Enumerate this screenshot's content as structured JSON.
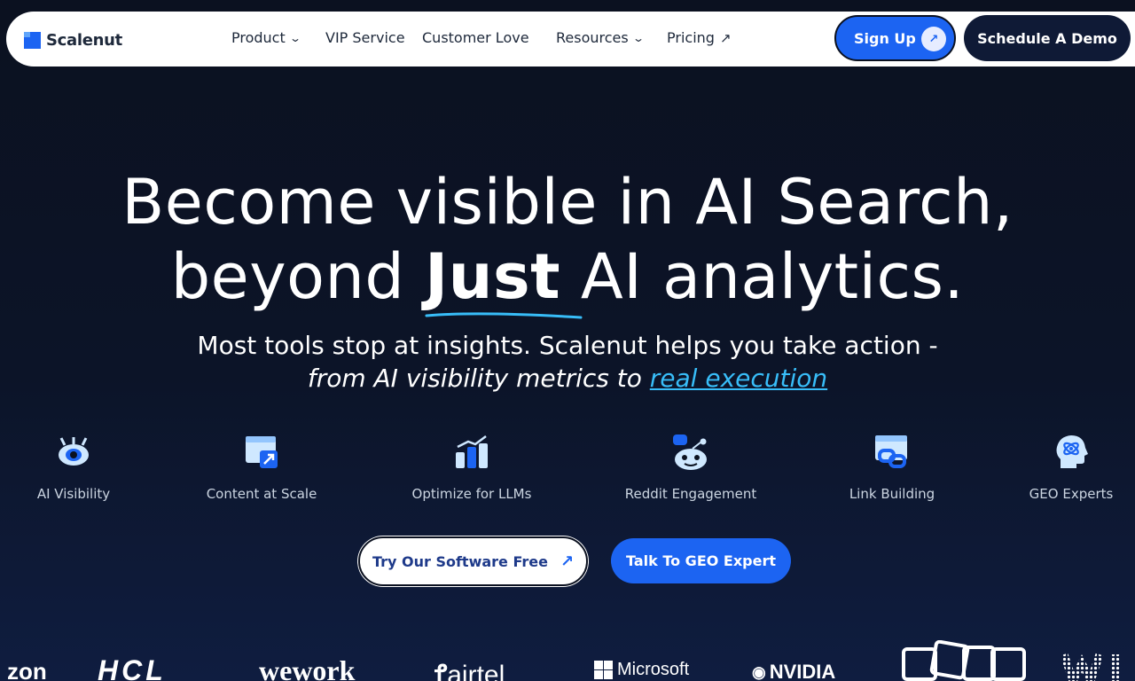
{
  "nav": {
    "brand": "Scalenut",
    "items": [
      {
        "label": "Product",
        "has_dropdown": true
      },
      {
        "label": "VIP Service",
        "has_dropdown": false
      },
      {
        "label": "Customer Love",
        "has_dropdown": false
      },
      {
        "label": "Resources",
        "has_dropdown": true
      },
      {
        "label": "Pricing",
        "external": true
      }
    ],
    "signup_label": "Sign Up",
    "demo_label": "Schedule A Demo"
  },
  "hero": {
    "line1": "Become visible in AI Search,",
    "line2_pre": "beyond ",
    "line2_emph": "Just",
    "line2_post": " AI analytics.",
    "sub1": "Most tools stop at insights. Scalenut helps you take action -",
    "sub2_pre": "from AI visibility metrics to ",
    "sub2_link": "real execution"
  },
  "features": [
    {
      "label": "AI Visibility",
      "icon": "eye-robot-icon"
    },
    {
      "label": "Content at Scale",
      "icon": "window-expand-icon"
    },
    {
      "label": "Optimize for LLMs",
      "icon": "bar-chart-icon"
    },
    {
      "label": "Reddit Engagement",
      "icon": "reddit-icon"
    },
    {
      "label": "Link Building",
      "icon": "link-icon"
    },
    {
      "label": "GEO Experts",
      "icon": "head-brain-icon"
    }
  ],
  "cta": {
    "try_label": "Try Our Software Free",
    "geo_label": "Talk To GEO Expert"
  },
  "logos": [
    "zon",
    "HCL",
    "wework",
    "airtel",
    "Microsoft",
    "NVIDIA"
  ],
  "colors": {
    "accent": "#1c64f2",
    "link": "#38bdf8",
    "bg": "#0b1120"
  }
}
